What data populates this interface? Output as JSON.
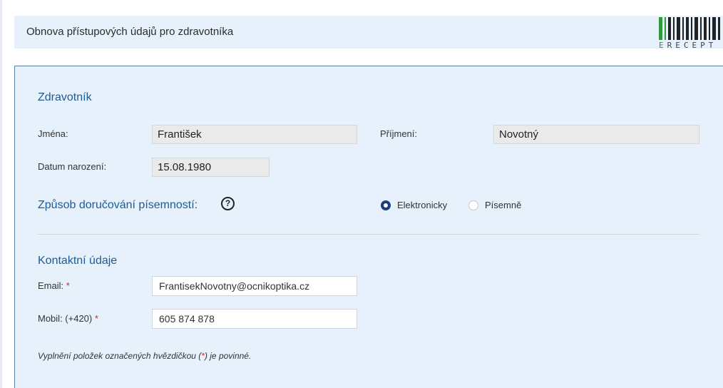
{
  "header": {
    "title": "Obnova přístupových údajů pro zdravotníka",
    "logo": {
      "text_e": "E",
      "text_rest": "RECEPT",
      "icon": "barcode-logo"
    }
  },
  "zdravotnik": {
    "section_title": "Zdravotník",
    "first_name_label": "Jména:",
    "first_name_value": "František",
    "last_name_label": "Příjmení:",
    "last_name_value": "Novotný",
    "dob_label": "Datum narození:",
    "dob_value": "15.08.1980"
  },
  "delivery": {
    "label": "Způsob doručování písemností:",
    "help_icon": "?",
    "options": [
      {
        "label": "Elektronicky",
        "selected": true
      },
      {
        "label": "Písemně",
        "selected": false
      }
    ]
  },
  "contact": {
    "section_title": "Kontaktní údaje",
    "email_label": "Email:",
    "email_value": "FrantisekNovotny@ocnikoptika.cz",
    "mobile_label": "Mobil: (+420)",
    "mobile_value": "605 874 878",
    "required_mark": "*"
  },
  "note": {
    "before": "Vyplnění položek označených hvězdičkou (",
    "star": "*",
    "after": ") je povinné."
  },
  "colors": {
    "accent": "#1f5a96",
    "panel_bg": "#e6f1fb",
    "required": "#d9252e",
    "radio": "#1d3d7a"
  }
}
